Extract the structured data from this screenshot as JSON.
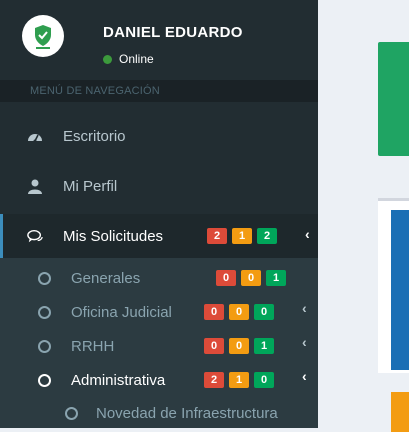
{
  "user": {
    "name": "DANIEL EDUARDO",
    "status": "Online",
    "status_color": "#3c9a3c"
  },
  "nav": {
    "header": "MENÚ DE NAVEGACIÓN",
    "items": [
      {
        "label": "Escritorio",
        "icon": "dashboard-icon"
      },
      {
        "label": "Mi Perfil",
        "icon": "user-icon"
      },
      {
        "label": "Mis Solicitudes",
        "icon": "comments-icon",
        "badges": [
          "2",
          "1",
          "2"
        ]
      }
    ],
    "submenu": [
      {
        "label": "Generales",
        "badges": [
          "0",
          "0",
          "1"
        ]
      },
      {
        "label": "Oficina Judicial",
        "badges": [
          "0",
          "0",
          "0"
        ]
      },
      {
        "label": "RRHH",
        "badges": [
          "0",
          "0",
          "1"
        ]
      },
      {
        "label": "Administrativa",
        "badges": [
          "2",
          "1",
          "0"
        ]
      }
    ],
    "subsubmenu": [
      {
        "label": "Novedad de Infraestructura"
      }
    ]
  },
  "colors": {
    "sidebar": "#222d32",
    "badge_red": "#dd4b39",
    "badge_orange": "#f39c12",
    "badge_green": "#00a65a",
    "accent": "#3c8dbc"
  }
}
